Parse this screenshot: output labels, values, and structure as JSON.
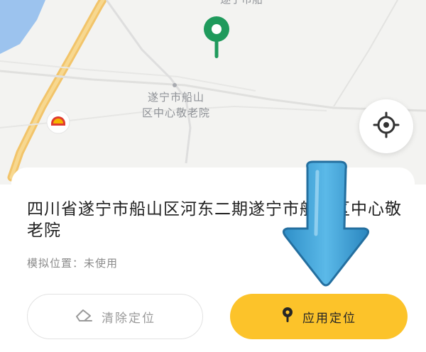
{
  "map": {
    "top_poi_label": "遂宁市船",
    "poi_label_line1": "遂宁市船山",
    "poi_label_line2": "区中心敬老院"
  },
  "location": {
    "address": "四川省遂宁市船山区河东二期遂宁市船山区中心敬老院",
    "status": "模拟位置：未使用"
  },
  "buttons": {
    "clear_label": "清除定位",
    "apply_label": "应用定位"
  },
  "colors": {
    "pin": "#1f9a5c",
    "apply_button": "#fcc32a",
    "overlay_arrow": "#3aa3d8"
  },
  "icons": {
    "pin": "map-pin-icon",
    "locate": "crosshair-icon",
    "clear": "eraser-icon",
    "apply": "location-pin-icon",
    "gas": "gas-station-icon",
    "arrow": "down-arrow-icon"
  }
}
